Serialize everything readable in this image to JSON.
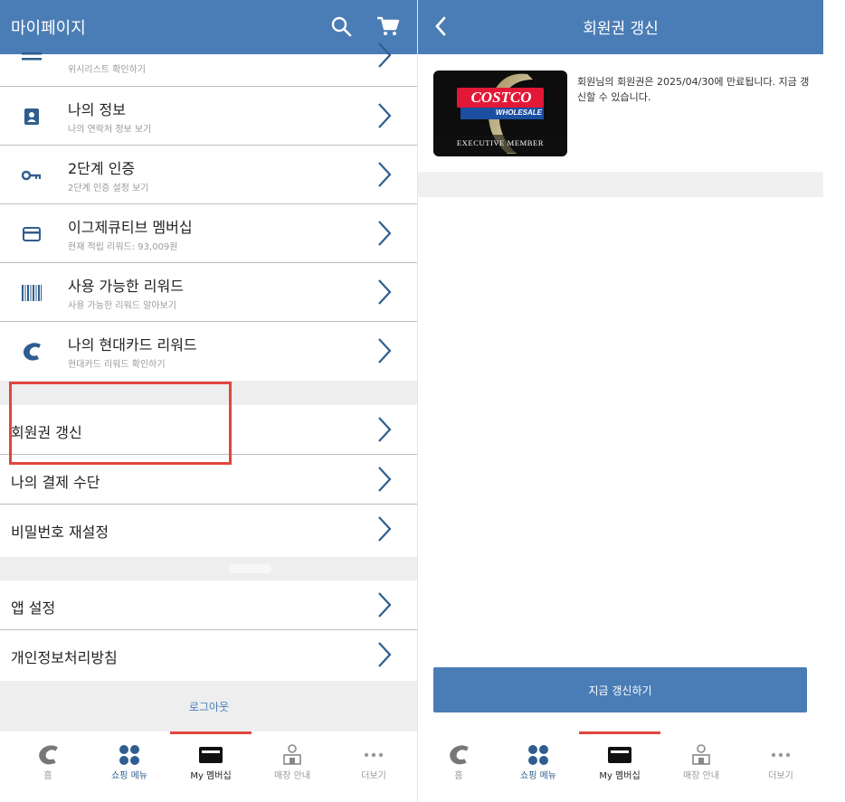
{
  "left": {
    "header": {
      "title": "마이페이지",
      "search_icon": "search-icon",
      "cart_icon": "cart-icon"
    },
    "menu_items": [
      {
        "title": "",
        "subtitle": "위시리스트 확인하기",
        "icon": "list-icon"
      },
      {
        "title": "나의 정보",
        "subtitle": "나의 연락처 정보 보기",
        "icon": "person-icon"
      },
      {
        "title": "2단계 인증",
        "subtitle": "2단계 인증 설정 보기",
        "icon": "key-icon"
      },
      {
        "title": "이그제큐티브 멤버십",
        "subtitle": "현재 적립 리워드: 93,009원",
        "icon": "card-icon"
      },
      {
        "title": "사용 가능한 리워드",
        "subtitle": "사용 가능한 리워드 알아보기",
        "icon": "barcode-icon"
      },
      {
        "title": "나의 현대카드 리워드",
        "subtitle": "현대카드 리워드 확인하기",
        "icon": "costco-c-icon"
      }
    ],
    "account_items": [
      "회원권  갱신",
      "나의 결제 수단",
      "비밀번호 재설정"
    ],
    "settings_items": [
      "앱 설정",
      "개인정보처리방침"
    ],
    "logout_label": "로그아웃"
  },
  "right": {
    "header": {
      "title": "회원권 갱신",
      "back_icon": "back-arrow-icon"
    },
    "card": {
      "brand_top": "COSTCO",
      "brand_bottom": "WHOLESALE",
      "tier": "EXECUTIVE MEMBER"
    },
    "message": "회원님의 회원권은 2025/04/30에 만료됩니다. 지금 갱신할 수 있습니다.",
    "renew_button": "지금 갱신하기"
  },
  "tabbar": {
    "tabs": [
      {
        "label": "홈",
        "icon": "costco-c-icon"
      },
      {
        "label": "쇼핑 메뉴",
        "icon": "grid-icon"
      },
      {
        "label": "My 멤버십",
        "icon": "membership-card-icon",
        "active": true
      },
      {
        "label": "매장 안내",
        "icon": "store-icon"
      },
      {
        "label": "더보기",
        "icon": "more-icon"
      }
    ]
  },
  "colors": {
    "header_blue": "#4a7db5",
    "highlight_red": "#e0463e",
    "active_tab_red": "#d9343b"
  }
}
